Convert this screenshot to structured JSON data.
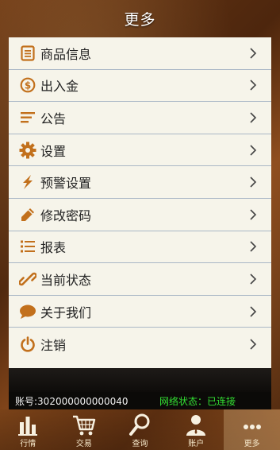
{
  "header": {
    "title": "更多"
  },
  "menu": {
    "items": [
      {
        "label": "商品信息",
        "icon": "document-icon"
      },
      {
        "label": "出入金",
        "icon": "dollar-coin-icon"
      },
      {
        "label": "公告",
        "icon": "list-lines-icon"
      },
      {
        "label": "设置",
        "icon": "gear-icon"
      },
      {
        "label": "预警设置",
        "icon": "lightning-icon"
      },
      {
        "label": "修改密码",
        "icon": "pencil-icon"
      },
      {
        "label": "报表",
        "icon": "bullet-list-icon"
      },
      {
        "label": "当前状态",
        "icon": "link-icon"
      },
      {
        "label": "关于我们",
        "icon": "chat-bubble-icon"
      },
      {
        "label": "注销",
        "icon": "power-icon"
      }
    ]
  },
  "status": {
    "account": "账号:302000000000040",
    "network": "网络状态：已连接"
  },
  "tabs": [
    {
      "label": "行情",
      "icon": "bar-chart-icon"
    },
    {
      "label": "交易",
      "icon": "shopping-cart-icon"
    },
    {
      "label": "查询",
      "icon": "magnifier-icon"
    },
    {
      "label": "账户",
      "icon": "user-icon"
    },
    {
      "label": "更多",
      "icon": "more-dots-icon"
    }
  ],
  "colors": {
    "icon_orange": "#c2701c",
    "network_green": "#33e033"
  }
}
